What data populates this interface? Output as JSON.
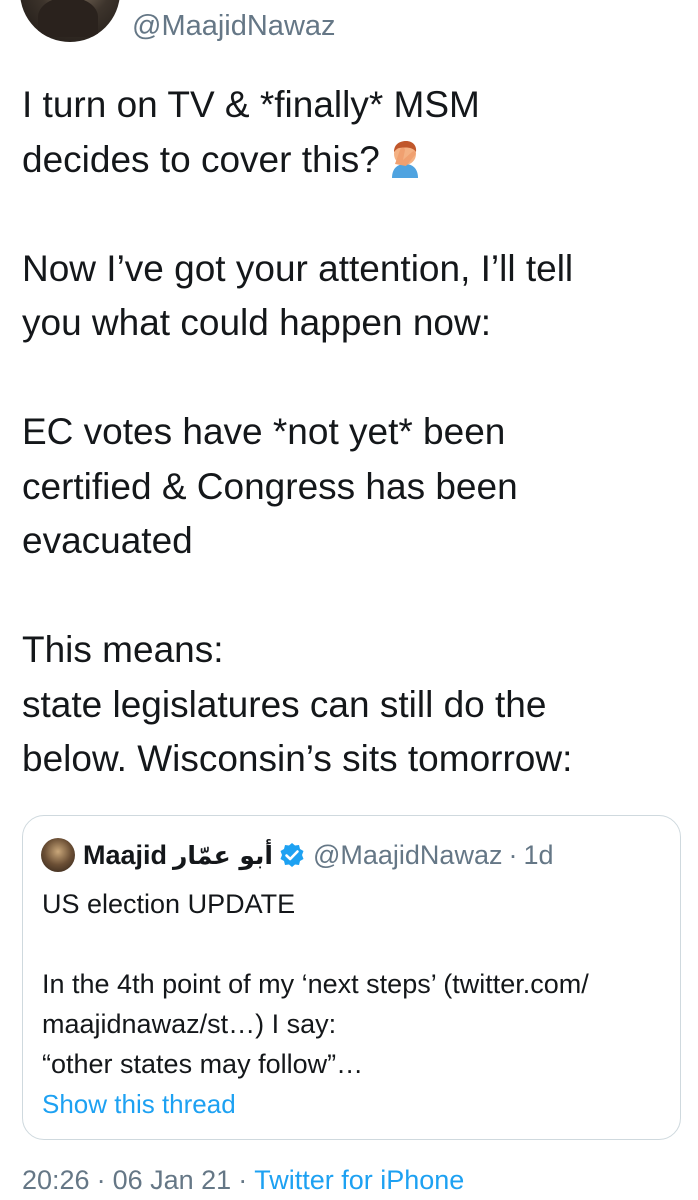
{
  "author": {
    "handle": "@MaajidNawaz"
  },
  "tweet": {
    "text_lines": [
      "I turn on TV & *finally* MSM",
      "decides to cover this?",
      "",
      "Now I’ve got your attention, I’ll tell",
      "you what could happen now:",
      "",
      "EC votes have *not yet* been",
      "certified & Congress has been",
      "evacuated",
      "",
      "This means:",
      "state legislatures can still do the",
      "below. Wisconsin’s sits tomorrow:"
    ],
    "emoji": "facepalm-emoji"
  },
  "quoted_tweet": {
    "name": "Maajid",
    "name_arabic": "أبو عمّار",
    "handle": "@MaajidNawaz",
    "separator": "·",
    "time": "1d",
    "text": "US election UPDATE\n\nIn the 4th point of my ‘next steps’ (twitter.com/\nmaajidnawaz/st…) I say:\n“other states may follow”…",
    "show_thread": "Show this thread"
  },
  "footer": {
    "time": "20:26",
    "date": "06 Jan 21",
    "separator": "·",
    "source": "Twitter for iPhone"
  },
  "colors": {
    "text": "#14171a",
    "secondary": "#657786",
    "link": "#1da1f2",
    "border": "#cfd9de"
  }
}
